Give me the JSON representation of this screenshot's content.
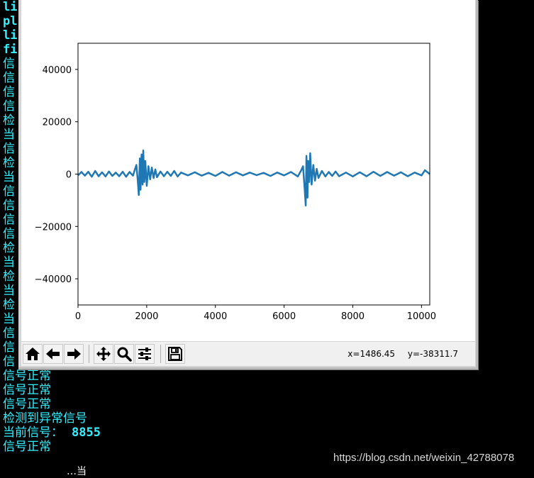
{
  "console": {
    "lines": [
      {
        "text": "li",
        "bold": true
      },
      {
        "text": "pl",
        "bold": true
      },
      {
        "text": "li",
        "bold": true
      },
      {
        "text": "fi",
        "bold": true
      },
      {
        "text": "信"
      },
      {
        "text": "信"
      },
      {
        "text": "信"
      },
      {
        "text": "信"
      },
      {
        "text": "检"
      },
      {
        "text": "当"
      },
      {
        "text": "信"
      },
      {
        "text": "检"
      },
      {
        "text": "当"
      },
      {
        "text": "信"
      },
      {
        "text": "信"
      },
      {
        "text": "信"
      },
      {
        "text": "信"
      },
      {
        "text": "检"
      },
      {
        "text": "当"
      },
      {
        "text": "检"
      },
      {
        "text": "当"
      },
      {
        "text": "检"
      },
      {
        "text": "当"
      },
      {
        "text": "信"
      },
      {
        "text": "信"
      },
      {
        "text": "信"
      },
      {
        "text": "信号正常"
      },
      {
        "text": "信号正常"
      },
      {
        "text": "信号正常"
      },
      {
        "text": "检测到异常信号"
      },
      {
        "text": "当前信号：",
        "value": "8855"
      },
      {
        "text": "信号正常"
      }
    ],
    "bottom_fragment": "…当"
  },
  "watermark": "https://blog.csdn.net/weixin_42788078",
  "figure": {
    "toolbar": {
      "home_label": "Home",
      "back_label": "Back",
      "forward_label": "Forward",
      "pan_label": "Pan",
      "zoom_label": "Zoom",
      "configure_label": "Configure subplots",
      "save_label": "Save"
    },
    "coords": {
      "x": "x=1486.45",
      "y": "y=-38311.7"
    }
  },
  "chart_data": {
    "type": "line",
    "title": "",
    "xlabel": "",
    "ylabel": "",
    "xlim": [
      0,
      10240
    ],
    "ylim": [
      -50000,
      50000
    ],
    "xticks": [
      0,
      2000,
      4000,
      6000,
      8000,
      10000
    ],
    "yticks": [
      -40000,
      -20000,
      0,
      20000,
      40000
    ],
    "xtick_labels": [
      "0",
      "2000",
      "4000",
      "6000",
      "8000",
      "10000"
    ],
    "ytick_labels": [
      "−40000",
      "−20000",
      "0",
      "20000",
      "40000"
    ],
    "grid": false,
    "series": [
      {
        "color": "#1f77b4",
        "x": [
          0,
          100,
          200,
          300,
          400,
          500,
          600,
          700,
          800,
          900,
          1000,
          1100,
          1200,
          1300,
          1400,
          1500,
          1600,
          1650,
          1700,
          1740,
          1770,
          1800,
          1820,
          1850,
          1880,
          1900,
          1930,
          1960,
          2000,
          2050,
          2100,
          2150,
          2200,
          2250,
          2300,
          2400,
          2500,
          2600,
          2700,
          2800,
          2900,
          3000,
          3200,
          3400,
          3600,
          3800,
          4000,
          4200,
          4400,
          4600,
          4800,
          5000,
          5200,
          5400,
          5600,
          5800,
          6000,
          6200,
          6400,
          6500,
          6550,
          6600,
          6630,
          6650,
          6680,
          6700,
          6730,
          6760,
          6800,
          6850,
          6900,
          6950,
          7000,
          7100,
          7200,
          7300,
          7400,
          7500,
          7600,
          7800,
          8000,
          8200,
          8400,
          8600,
          8800,
          9000,
          9200,
          9400,
          9600,
          9800,
          10000,
          10100,
          10240
        ],
        "y": [
          -500,
          800,
          -600,
          900,
          -1000,
          1200,
          -800,
          700,
          -900,
          1000,
          -700,
          600,
          -800,
          900,
          -1000,
          800,
          -600,
          1500,
          3500,
          -2500,
          -8000,
          6000,
          -6000,
          7500,
          -4000,
          9000,
          -3000,
          5000,
          -4500,
          3000,
          -2000,
          2500,
          -1500,
          1800,
          -1200,
          1000,
          -800,
          900,
          -700,
          1200,
          -900,
          600,
          -500,
          700,
          -600,
          500,
          -700,
          800,
          -600,
          700,
          -500,
          600,
          -400,
          500,
          -700,
          600,
          -500,
          800,
          -900,
          1500,
          3000,
          -6000,
          -12000,
          7000,
          -9000,
          5000,
          -3000,
          8000,
          -4000,
          3500,
          -2500,
          2000,
          -1500,
          1200,
          -900,
          800,
          -700,
          1000,
          -800,
          600,
          -900,
          700,
          -800,
          900,
          -700,
          800,
          -600,
          700,
          -800,
          600,
          -500,
          1500,
          0
        ]
      }
    ]
  }
}
